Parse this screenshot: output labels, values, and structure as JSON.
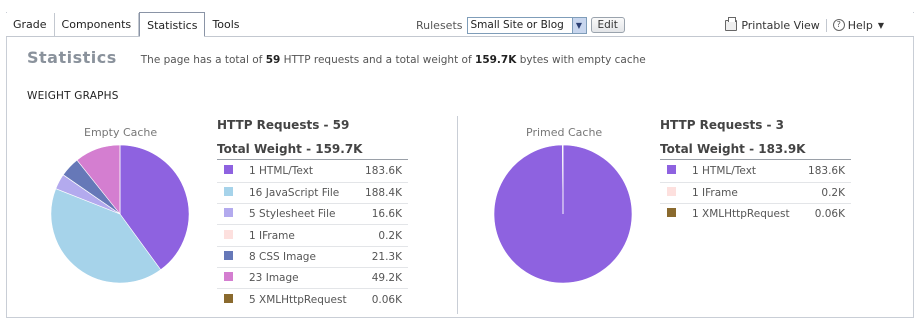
{
  "tabs": [
    {
      "label": "Grade",
      "active": false
    },
    {
      "label": "Components",
      "active": false
    },
    {
      "label": "Statistics",
      "active": true
    },
    {
      "label": "Tools",
      "active": false
    }
  ],
  "ruleset": {
    "label": "Rulesets",
    "selected": "Small Site or Blog",
    "edit_label": "Edit"
  },
  "toolbar_right": {
    "printable_view": "Printable View",
    "help": "Help"
  },
  "page": {
    "title": "Statistics",
    "summary_prefix": "The page has a total of",
    "summary_requests": "59",
    "summary_middle": "HTTP requests and a total weight of",
    "summary_weight": "159.7K",
    "summary_suffix": "bytes with empty cache",
    "section_title": "WEIGHT GRAPHS"
  },
  "colors": {
    "html": "#8e62e0",
    "js": "#a6d3ea",
    "css": "#b3aaee",
    "iframe": "#fde0de",
    "cssimage": "#6678b8",
    "image": "#d47ed0",
    "xhr": "#8a6a2e"
  },
  "empty_cache": {
    "label": "Empty Cache",
    "requests_heading": "HTTP Requests - 59",
    "weight_heading": "Total Weight - 159.7K",
    "rows": [
      {
        "count": "1",
        "type": "HTML/Text",
        "size": "183.6K",
        "color": "#8e62e0",
        "bytes": 183.6
      },
      {
        "count": "16",
        "type": "JavaScript File",
        "size": "188.4K",
        "color": "#a6d3ea",
        "bytes": 188.4
      },
      {
        "count": "5",
        "type": "Stylesheet File",
        "size": "16.6K",
        "color": "#b3aaee",
        "bytes": 16.6
      },
      {
        "count": "1",
        "type": "IFrame",
        "size": "0.2K",
        "color": "#fde0de",
        "bytes": 0.2
      },
      {
        "count": "8",
        "type": "CSS Image",
        "size": "21.3K",
        "color": "#6678b8",
        "bytes": 21.3
      },
      {
        "count": "23",
        "type": "Image",
        "size": "49.2K",
        "color": "#d47ed0",
        "bytes": 49.2
      },
      {
        "count": "5",
        "type": "XMLHttpRequest",
        "size": "0.06K",
        "color": "#8a6a2e",
        "bytes": 0.06
      }
    ]
  },
  "primed_cache": {
    "label": "Primed Cache",
    "requests_heading": "HTTP Requests - 3",
    "weight_heading": "Total Weight - 183.9K",
    "rows": [
      {
        "count": "1",
        "type": "HTML/Text",
        "size": "183.6K",
        "color": "#8e62e0",
        "bytes": 183.6
      },
      {
        "count": "1",
        "type": "IFrame",
        "size": "0.2K",
        "color": "#fde0de",
        "bytes": 0.2
      },
      {
        "count": "1",
        "type": "XMLHttpRequest",
        "size": "0.06K",
        "color": "#8a6a2e",
        "bytes": 0.06
      }
    ]
  }
}
